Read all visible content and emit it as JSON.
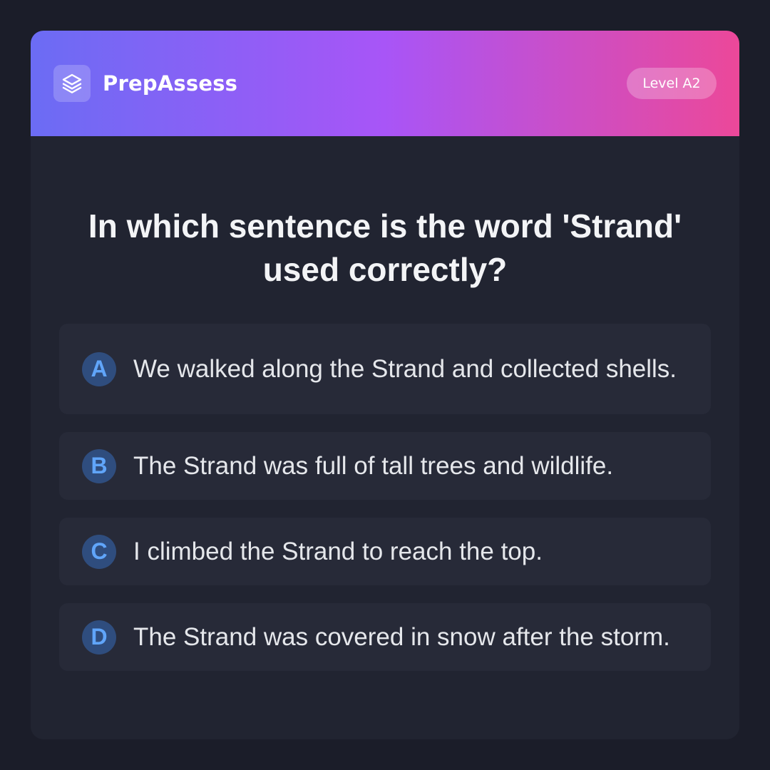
{
  "app": {
    "name": "PrepAssess",
    "logo_icon": "layers-icon",
    "level_badge": "Level A2"
  },
  "colors": {
    "page_background": "#1b1d29",
    "card_background": "#212431",
    "header_gradient": [
      "#6b6cf4",
      "#a855f7",
      "#ec4899"
    ],
    "option_background": "#272a38",
    "option_letter_background": "#2f4d7e",
    "option_letter_color": "#60a5fa"
  },
  "question": {
    "text": "In which sentence is the word 'Strand' used correctly?"
  },
  "options": [
    {
      "letter": "A",
      "text": "We walked along the Strand and collected shells."
    },
    {
      "letter": "B",
      "text": "The Strand was full of tall trees and wildlife."
    },
    {
      "letter": "C",
      "text": "I climbed the Strand to reach the top."
    },
    {
      "letter": "D",
      "text": "The Strand was covered in snow after the storm."
    }
  ]
}
